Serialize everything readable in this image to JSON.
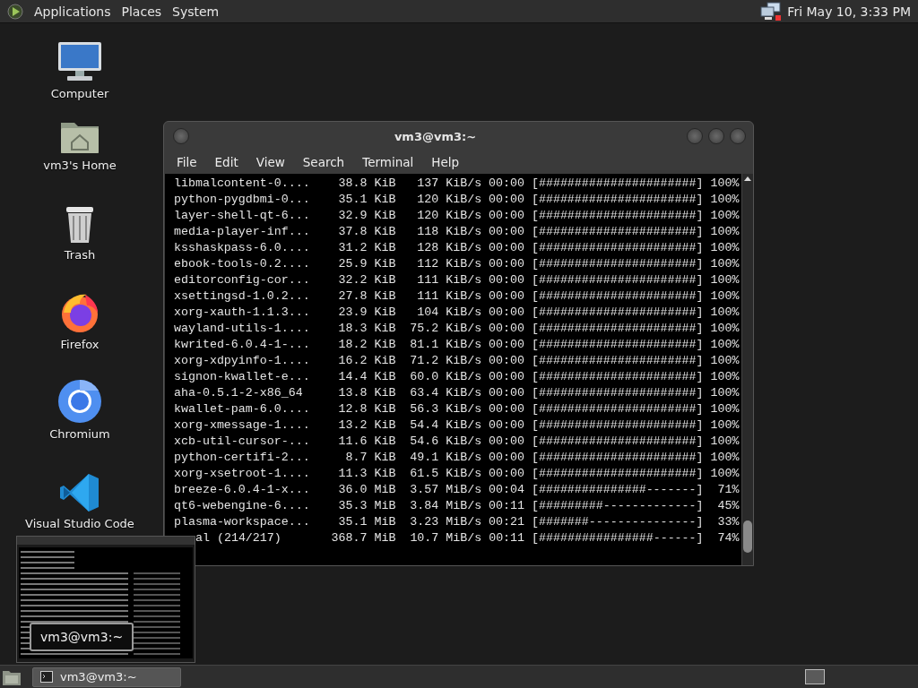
{
  "top_panel": {
    "menus": [
      "Applications",
      "Places",
      "System"
    ],
    "clock": "Fri May 10, 3:33 PM"
  },
  "desktop_icons": [
    {
      "label": "Computer",
      "kind": "computer"
    },
    {
      "label": "vm3's Home",
      "kind": "home"
    },
    {
      "label": "Trash",
      "kind": "trash"
    },
    {
      "label": "Firefox",
      "kind": "firefox"
    },
    {
      "label": "Chromium",
      "kind": "chromium"
    },
    {
      "label": "Visual Studio Code",
      "kind": "vscode"
    }
  ],
  "terminal": {
    "title": "vm3@vm3:~",
    "menus": [
      "File",
      "Edit",
      "View",
      "Search",
      "Terminal",
      "Help"
    ],
    "rows": [
      {
        "name": "libmalcontent-0....",
        "size": "38.8 KiB",
        "rate": "137 KiB/s",
        "eta": "00:00",
        "bar": "[######################]",
        "percent": "100%"
      },
      {
        "name": "python-pygdbmi-0...",
        "size": "35.1 KiB",
        "rate": "120 KiB/s",
        "eta": "00:00",
        "bar": "[######################]",
        "percent": "100%"
      },
      {
        "name": "layer-shell-qt-6...",
        "size": "32.9 KiB",
        "rate": "120 KiB/s",
        "eta": "00:00",
        "bar": "[######################]",
        "percent": "100%"
      },
      {
        "name": "media-player-inf...",
        "size": "37.8 KiB",
        "rate": "118 KiB/s",
        "eta": "00:00",
        "bar": "[######################]",
        "percent": "100%"
      },
      {
        "name": "ksshaskpass-6.0....",
        "size": "31.2 KiB",
        "rate": "128 KiB/s",
        "eta": "00:00",
        "bar": "[######################]",
        "percent": "100%"
      },
      {
        "name": "ebook-tools-0.2....",
        "size": "25.9 KiB",
        "rate": "112 KiB/s",
        "eta": "00:00",
        "bar": "[######################]",
        "percent": "100%"
      },
      {
        "name": "editorconfig-cor...",
        "size": "32.2 KiB",
        "rate": "111 KiB/s",
        "eta": "00:00",
        "bar": "[######################]",
        "percent": "100%"
      },
      {
        "name": "xsettingsd-1.0.2...",
        "size": "27.8 KiB",
        "rate": "111 KiB/s",
        "eta": "00:00",
        "bar": "[######################]",
        "percent": "100%"
      },
      {
        "name": "xorg-xauth-1.1.3...",
        "size": "23.9 KiB",
        "rate": "104 KiB/s",
        "eta": "00:00",
        "bar": "[######################]",
        "percent": "100%"
      },
      {
        "name": "wayland-utils-1....",
        "size": "18.3 KiB",
        "rate": "75.2 KiB/s",
        "eta": "00:00",
        "bar": "[######################]",
        "percent": "100%"
      },
      {
        "name": "kwrited-6.0.4-1-...",
        "size": "18.2 KiB",
        "rate": "81.1 KiB/s",
        "eta": "00:00",
        "bar": "[######################]",
        "percent": "100%"
      },
      {
        "name": "xorg-xdpyinfo-1....",
        "size": "16.2 KiB",
        "rate": "71.2 KiB/s",
        "eta": "00:00",
        "bar": "[######################]",
        "percent": "100%"
      },
      {
        "name": "signon-kwallet-e...",
        "size": "14.4 KiB",
        "rate": "60.0 KiB/s",
        "eta": "00:00",
        "bar": "[######################]",
        "percent": "100%"
      },
      {
        "name": "aha-0.5.1-2-x86_64",
        "size": "13.8 KiB",
        "rate": "63.4 KiB/s",
        "eta": "00:00",
        "bar": "[######################]",
        "percent": "100%"
      },
      {
        "name": "kwallet-pam-6.0....",
        "size": "12.8 KiB",
        "rate": "56.3 KiB/s",
        "eta": "00:00",
        "bar": "[######################]",
        "percent": "100%"
      },
      {
        "name": "xorg-xmessage-1....",
        "size": "13.2 KiB",
        "rate": "54.4 KiB/s",
        "eta": "00:00",
        "bar": "[######################]",
        "percent": "100%"
      },
      {
        "name": "xcb-util-cursor-...",
        "size": "11.6 KiB",
        "rate": "54.6 KiB/s",
        "eta": "00:00",
        "bar": "[######################]",
        "percent": "100%"
      },
      {
        "name": "python-certifi-2...",
        "size": "8.7 KiB",
        "rate": "49.1 KiB/s",
        "eta": "00:00",
        "bar": "[######################]",
        "percent": "100%"
      },
      {
        "name": "xorg-xsetroot-1....",
        "size": "11.3 KiB",
        "rate": "61.5 KiB/s",
        "eta": "00:00",
        "bar": "[######################]",
        "percent": "100%"
      },
      {
        "name": "breeze-6.0.4-1-x...",
        "size": "36.0 MiB",
        "rate": "3.57 MiB/s",
        "eta": "00:04",
        "bar": "[###############-------]",
        "percent": "71%"
      },
      {
        "name": "qt6-webengine-6....",
        "size": "35.3 MiB",
        "rate": "3.84 MiB/s",
        "eta": "00:11",
        "bar": "[#########-------------]",
        "percent": "45%"
      },
      {
        "name": "plasma-workspace...",
        "size": "35.1 MiB",
        "rate": "3.23 MiB/s",
        "eta": "00:21",
        "bar": "[#######---------------]",
        "percent": "33%"
      },
      {
        "name": "al (214/217)",
        "size": "368.7 MiB",
        "rate": "10.7 MiB/s",
        "eta": "00:11",
        "bar": "[################------]",
        "percent": "74%",
        "kind": "partly_covered"
      }
    ]
  },
  "preview": {
    "title": "vm3@vm3:~"
  },
  "taskbar": {
    "tasks": [
      {
        "label": "vm3@vm3:~",
        "selected": true
      }
    ]
  }
}
